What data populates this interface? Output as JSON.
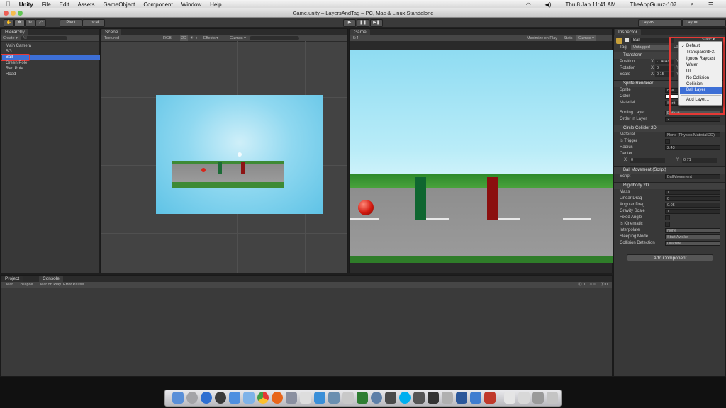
{
  "menubar": {
    "apple": "",
    "app": "Unity",
    "menus": [
      "File",
      "Edit",
      "Assets",
      "GameObject",
      "Component",
      "Window",
      "Help"
    ],
    "clock": "Thu 8 Jan  11:41 AM",
    "user": "TheAppGuruz-107"
  },
  "window": {
    "title": "Game.unity – LayersAndTag – PC, Mac & Linux Standalone"
  },
  "toolbar": {
    "pivot": "Pivot",
    "local": "Local",
    "layers": "Layers",
    "layout": "Layout"
  },
  "hierarchy": {
    "tab": "Hierarchy",
    "create": "Create ▾",
    "search_placeholder": "All",
    "items": [
      "Main Camera",
      "BG",
      "Ball",
      "Green Pole",
      "Red Pole",
      "Road"
    ]
  },
  "scene": {
    "tab": "Scene",
    "shading": "Textured",
    "render": "RGB",
    "mode2d": "2D",
    "effects": "Effects ▾",
    "gizmos": "Gizmos ▾"
  },
  "game": {
    "tab": "Game",
    "aspect": "5:4",
    "maximize": "Maximize on Play",
    "stats": "Stats",
    "gizmos": "Gizmos ▾"
  },
  "inspector": {
    "tab": "Inspector",
    "object_name": "Ball",
    "static": "Static ▾",
    "tag_label": "Tag",
    "tag_value": "Untagged",
    "layer_label": "La",
    "transform": {
      "title": "Transform",
      "position": "Position",
      "rotation": "Rotation",
      "scale": "Scale",
      "pos_x": "-1.4049",
      "rot_x": "0",
      "scale_x": "0.15",
      "x": "X",
      "y": "Y"
    },
    "sprite_renderer": {
      "title": "Sprite Renderer",
      "sprite": "Sprite",
      "sprite_val": "Ball",
      "color": "Color",
      "material": "Material",
      "material_val": "Sprit",
      "sorting_layer": "Sorting Layer",
      "sorting_val": "Default",
      "order": "Order in Layer",
      "order_val": "2"
    },
    "circle_collider": {
      "title": "Circle Collider 2D",
      "material": "Material",
      "material_val": "None (Physics Material 2D)",
      "trigger": "Is Trigger",
      "radius": "Radius",
      "radius_val": "2.43",
      "center": "Center",
      "cx": "X",
      "cx_val": "0",
      "cy": "Y",
      "cy_val": "0.71"
    },
    "ball_movement": {
      "title": "Ball Movement (Script)",
      "script": "Script",
      "script_val": "BallMovement"
    },
    "rigidbody": {
      "title": "Rigidbody 2D",
      "mass": "Mass",
      "mass_val": "1",
      "linear_drag": "Linear Drag",
      "linear_drag_val": "0",
      "angular_drag": "Angular Drag",
      "angular_drag_val": "0.05",
      "gravity": "Gravity Scale",
      "gravity_val": "1",
      "fixed_angle": "Fixed Angle",
      "kinematic": "Is Kinematic",
      "interpolate": "Interpolate",
      "interpolate_val": "None",
      "sleeping": "Sleeping Mode",
      "sleeping_val": "Start Awake",
      "collision": "Collision Detection",
      "collision_val": "Discrete"
    },
    "add_component": "Add Component"
  },
  "layer_dropdown": {
    "options": [
      "Default",
      "TransparentFX",
      "Ignore Raycast",
      "Water",
      "UI",
      "No Collision",
      "Collision",
      "Ball Layer"
    ],
    "checked": "✓",
    "add": "Add Layer..."
  },
  "bottom": {
    "tab_project": "Project",
    "tab_console": "Console",
    "clear": "Clear",
    "collapse": "Collapse",
    "clear_on_play": "Clear on Play",
    "error_pause": "Error Pause",
    "counts": [
      "0",
      "0",
      "0"
    ]
  },
  "colors": {
    "accent": "#3d6fd6",
    "highlight_red": "#e53935",
    "sky": "#8fdcf2"
  }
}
